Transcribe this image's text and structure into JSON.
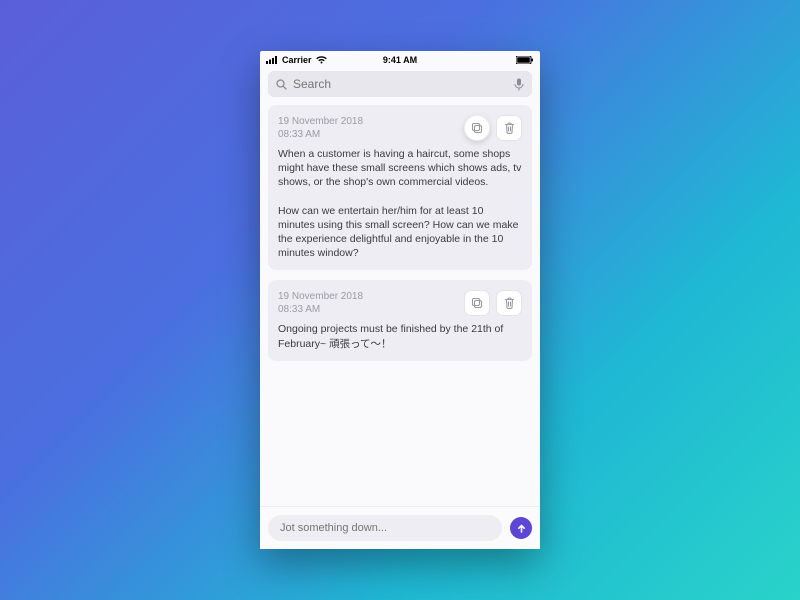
{
  "statusbar": {
    "carrier": "Carrier",
    "time": "9:41 AM"
  },
  "search": {
    "placeholder": "Search"
  },
  "notes": [
    {
      "date": "19 November 2018",
      "time": "08:33 AM",
      "body": "When a customer is having a haircut, some shops might have these small screens which shows ads, tv shows, or the shop's own commercial videos.\n\nHow can we entertain her/him for at least 10 minutes using this small screen? How can we make the experience delightful and enjoyable in the 10 minutes window?",
      "copy_highlighted": true
    },
    {
      "date": "19 November 2018",
      "time": "08:33 AM",
      "body": "Ongoing projects must be finished by the 21th of February~ 頑張って〜！",
      "copy_highlighted": false
    }
  ],
  "composer": {
    "placeholder": "Jot something down..."
  },
  "colors": {
    "accent": "#5b46d9"
  }
}
